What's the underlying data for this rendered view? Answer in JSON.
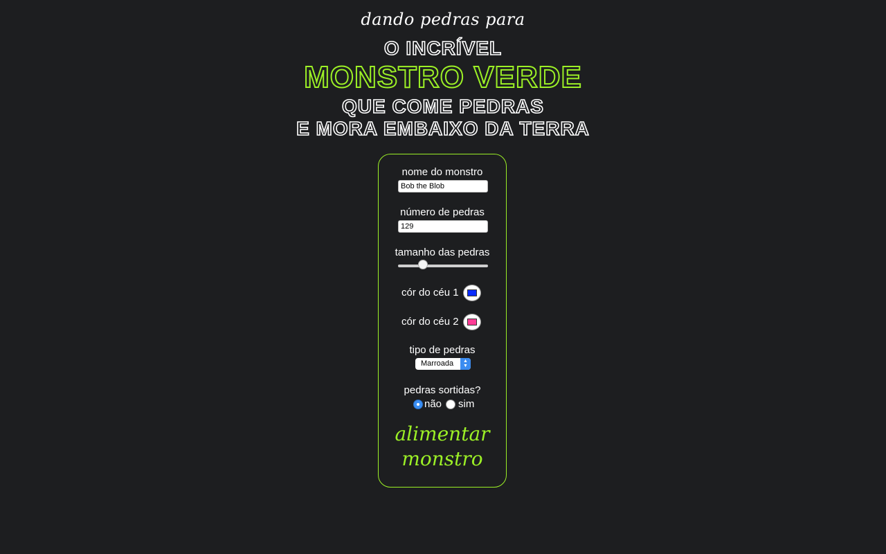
{
  "header": {
    "subtitle": "dando pedras para",
    "line1": "O INCRÍVEL",
    "line2": "MONSTRO VERDE",
    "line3": "QUE COME PEDRAS",
    "line4": "E MORA EMBAIXO DA TERRA"
  },
  "form": {
    "monster_name": {
      "label": "nome do monstro",
      "value": "Bob the Blob"
    },
    "rock_count": {
      "label": "número de pedras",
      "value": "129"
    },
    "rock_size": {
      "label": "tamanho das pedras",
      "value_fraction": 0.25
    },
    "sky_color_1": {
      "label": "cór do céu 1",
      "color": "#0a2cff"
    },
    "sky_color_2": {
      "label": "cór do céu 2",
      "color": "#ff3d96"
    },
    "rock_type": {
      "label": "tipo de pedras",
      "selected": "Marroada"
    },
    "assorted": {
      "label": "pedras sortidas?",
      "options": [
        "não",
        "sim"
      ],
      "selected": "não"
    },
    "submit_label": "alimentar monstro"
  },
  "colors": {
    "background": "#1d1e20",
    "accent": "#9cf026",
    "text": "#ffffff"
  }
}
